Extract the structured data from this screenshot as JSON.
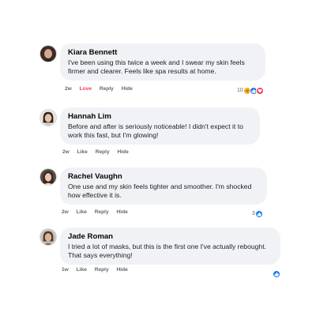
{
  "comments": [
    {
      "name": "Kiara Bennett",
      "text": "I've been using this twice a week and I swear my skin feels firmer and clearer. Feels like spa results at home.",
      "time": "2w",
      "like_label": "Love",
      "reply_label": "Reply",
      "hide_label": "Hide",
      "reaction_count": "10",
      "reactions": [
        "haha-icon",
        "like-icon",
        "heart-icon"
      ]
    },
    {
      "name": "Hannah Lim",
      "text": "Before and after is seriously noticeable! I didn't expect it to work this fast, but I'm glowing!",
      "time": "2w",
      "like_label": "Like",
      "reply_label": "Reply",
      "hide_label": "Hide"
    },
    {
      "name": "Rachel Vaughn",
      "text": "One use and my skin feels tighter and smoother. I'm shocked how effective it is.",
      "time": "2w",
      "like_label": "Like",
      "reply_label": "Reply",
      "hide_label": "Hide",
      "reaction_count": "3",
      "reactions": [
        "like-icon"
      ]
    },
    {
      "name": "Jade Roman",
      "text": "I tried a lot of masks, but this is the first one I've actually rebought. That says everything!",
      "time": "1w",
      "like_label": "Like",
      "reply_label": "Reply",
      "hide_label": "Hide",
      "reactions": [
        "like-icon"
      ]
    }
  ],
  "colors": {
    "bubble": "#f0f2f5",
    "meta_text": "#65676b",
    "love": "#f33e58",
    "like_blue": "#1877f2"
  }
}
